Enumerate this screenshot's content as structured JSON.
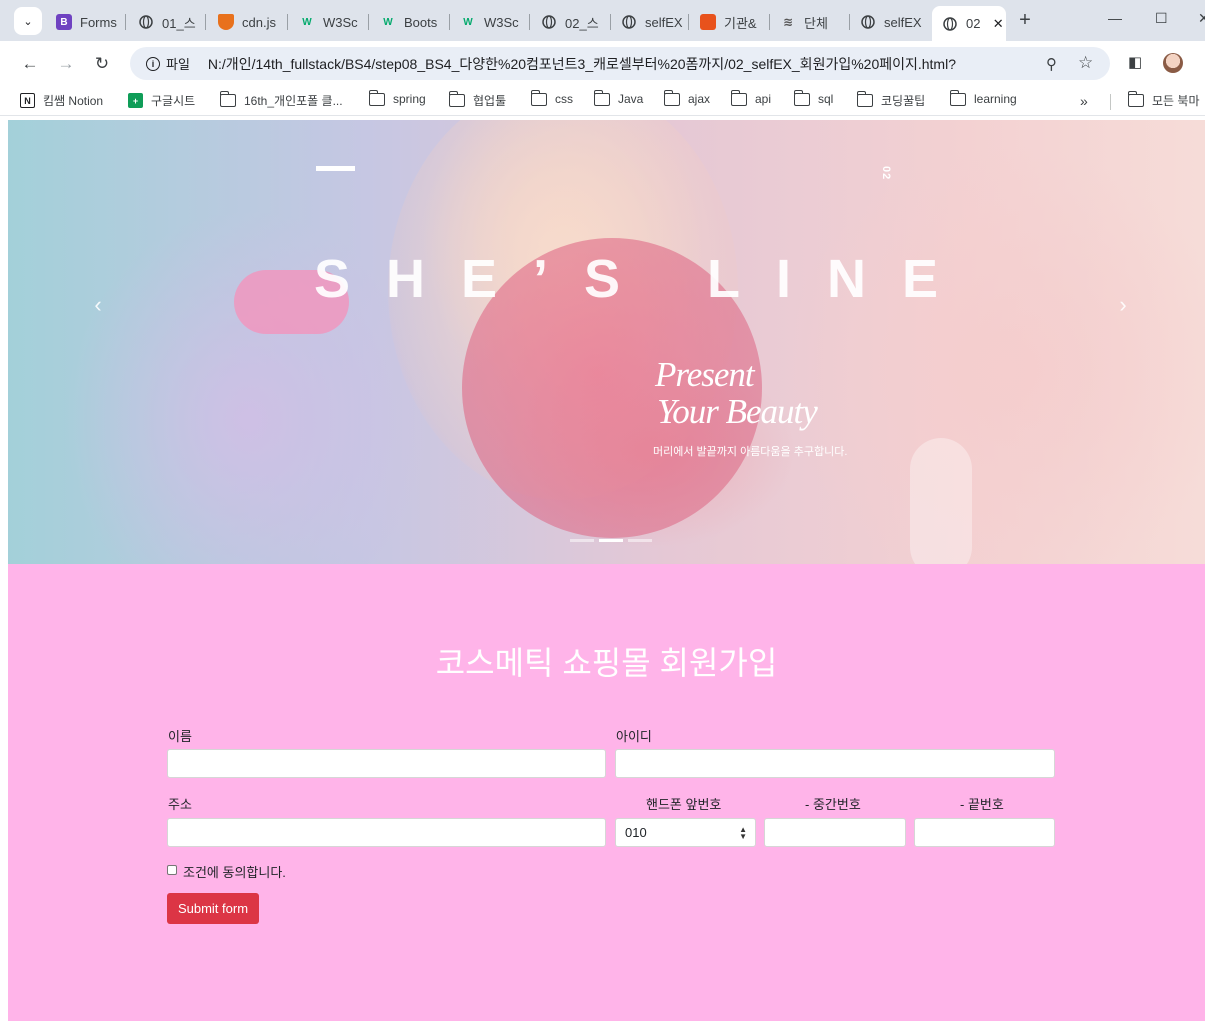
{
  "browser": {
    "tabs": [
      {
        "label": "Forms",
        "favicon": "B",
        "favicon_color": "#6f42c1"
      },
      {
        "label": "01_스",
        "favicon": "globe"
      },
      {
        "label": "cdn.js",
        "favicon": "shield",
        "favicon_color": "#e8711c"
      },
      {
        "label": "W3Sc",
        "favicon": "w3",
        "favicon_color": "#04aa6d"
      },
      {
        "label": "Boots",
        "favicon": "w3",
        "favicon_color": "#04aa6d"
      },
      {
        "label": "W3Sc",
        "favicon": "w3",
        "favicon_color": "#04aa6d"
      },
      {
        "label": "02_스",
        "favicon": "globe"
      },
      {
        "label": "selfEX",
        "favicon": "globe"
      },
      {
        "label": "기관&",
        "favicon": "square",
        "favicon_color": "#e8521c"
      },
      {
        "label": "단체",
        "favicon": "wave"
      },
      {
        "label": "selfEX",
        "favicon": "globe"
      }
    ],
    "active_tab": {
      "label": "02",
      "close_label": "✕"
    },
    "new_tab_label": "+",
    "url_chip": "파일",
    "url": "N:/개인/14th_fullstack/BS4/step08_BS4_다양한%20컴포넌트3_캐로셀부터%20폼까지/02_selfEX_회원가입%20페이지.html?",
    "bookmarks": [
      {
        "label": "킴쌤 Notion",
        "type": "notion"
      },
      {
        "label": "구글시트",
        "type": "sheets"
      },
      {
        "label": "16th_개인포폴 클...",
        "type": "folder"
      },
      {
        "label": "spring",
        "type": "folder"
      },
      {
        "label": "협업툴",
        "type": "folder"
      },
      {
        "label": "css",
        "type": "folder"
      },
      {
        "label": "Java",
        "type": "folder"
      },
      {
        "label": "ajax",
        "type": "folder"
      },
      {
        "label": "api",
        "type": "folder"
      },
      {
        "label": "sql",
        "type": "folder"
      },
      {
        "label": "코딩꿀팁",
        "type": "folder"
      },
      {
        "label": "learning",
        "type": "folder"
      }
    ],
    "bookmarks_more": "»",
    "all_bookmarks": "모든 북마"
  },
  "carousel": {
    "slide_number": "02",
    "headline": "SHE’S LINE",
    "script_line1": "Present",
    "script_line2": "Your Beauty",
    "subtitle": "머리에서 발끝까지 아름다움을 추구합니다.",
    "prev_label": "‹",
    "next_label": "›",
    "indicator_count": 3,
    "active_indicator": 1
  },
  "form": {
    "title": "코스메틱 쇼핑몰 회원가입",
    "name_label": "이름",
    "id_label": "아이디",
    "address_label": "주소",
    "phone_prefix_label": "핸드폰 앞번호",
    "phone_middle_label": "- 중간번호",
    "phone_last_label": "- 끝번호",
    "phone_prefix_value": "010",
    "agree_label": "조건에 동의합니다.",
    "submit_label": "Submit form"
  },
  "colors": {
    "page_background": "#ffb4e9",
    "submit_button": "#dc3545"
  }
}
